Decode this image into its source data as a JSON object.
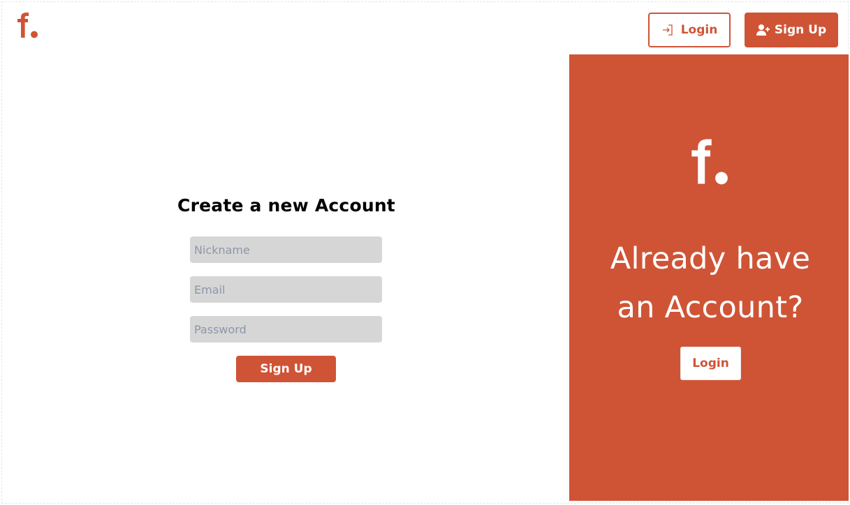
{
  "colors": {
    "brand": "#cf5436",
    "field_bg": "#d6d6d6",
    "placeholder": "#8e96a8"
  },
  "header": {
    "logo_icon": "f-dot-logo",
    "login_label": "Login",
    "login_icon": "sign-in-icon",
    "signup_label": "Sign Up",
    "signup_icon": "user-plus-icon"
  },
  "form": {
    "title": "Create a new Account",
    "nickname_placeholder": "Nickname",
    "email_placeholder": "Email",
    "password_placeholder": "Password",
    "nickname_value": "",
    "email_value": "",
    "password_value": "",
    "submit_label": "Sign Up"
  },
  "panel": {
    "logo_icon": "f-dot-logo",
    "heading_line1": "Already have",
    "heading_line2": "an Account?",
    "login_label": "Login"
  }
}
